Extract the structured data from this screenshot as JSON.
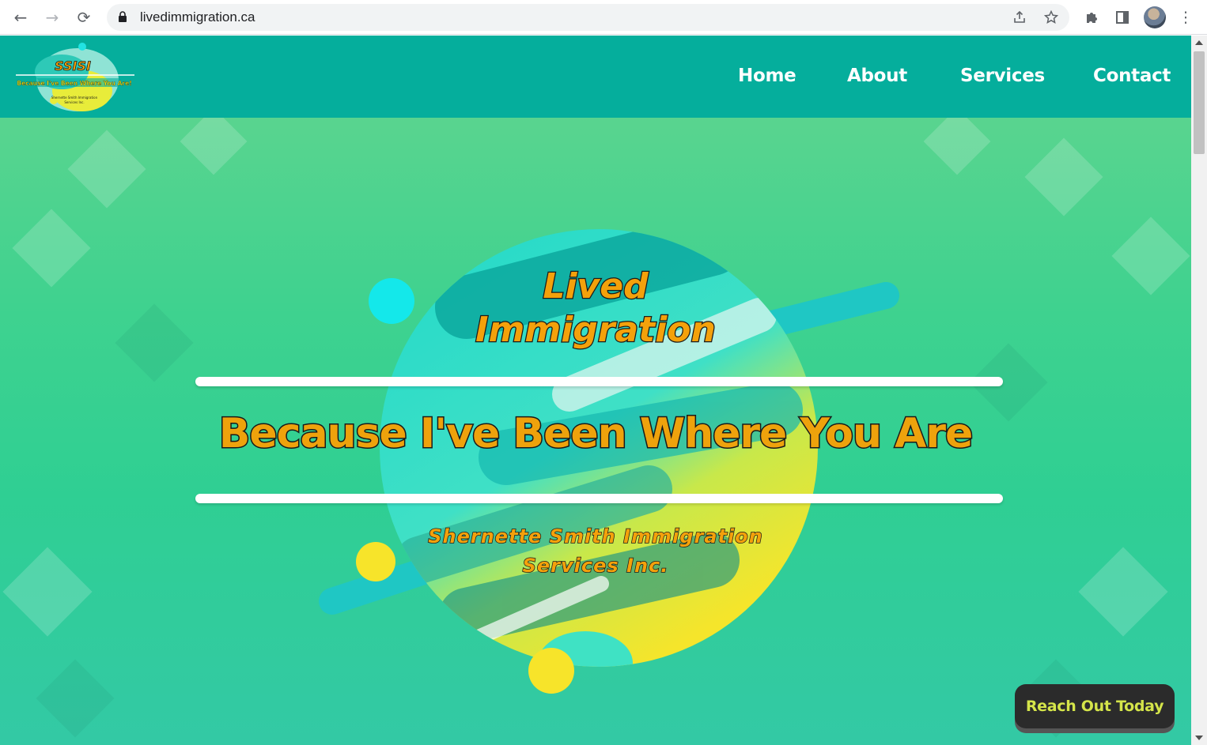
{
  "browser": {
    "url": "livedimmigration.ca",
    "back_glyph": "←",
    "forward_glyph": "→",
    "reload_glyph": "⟳",
    "menu_glyph": "⋮"
  },
  "site": {
    "logo": {
      "title": "SSISI",
      "tagline": "Because I've Been Where You Are!",
      "small_text": "Shernette Smith Immigration Services Inc."
    },
    "nav": [
      {
        "label": "Home"
      },
      {
        "label": "About"
      },
      {
        "label": "Services"
      },
      {
        "label": "Contact"
      }
    ],
    "hero": {
      "title_line1": "Lived",
      "title_line2": "Immigration",
      "tagline": "Because I've Been Where You Are",
      "subtitle_line1": "Shernette Smith Immigration",
      "subtitle_line2": "Services Inc."
    },
    "cta_label": "Reach Out Today"
  },
  "colors": {
    "header": "#05ae9c",
    "title_fill": "#f4a10b",
    "cta_bg": "#2b2b2b",
    "cta_text": "#d5e54a"
  }
}
